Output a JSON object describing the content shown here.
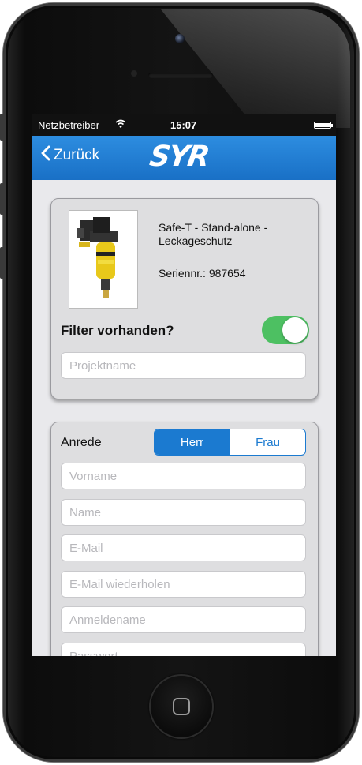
{
  "status_bar": {
    "carrier": "Netzbetreiber",
    "time": "15:07",
    "wifi_icon": "wifi-icon",
    "battery_icon": "battery-icon"
  },
  "nav": {
    "back_label": "Zurück",
    "logo_text": "SYR"
  },
  "product": {
    "title": "Safe-T - Stand-alone - Leckageschutz",
    "serial": "Seriennr.: 987654",
    "filter_label": "Filter vorhanden?",
    "filter_enabled": true,
    "project_placeholder": "Projektname"
  },
  "form": {
    "anrede_label": "Anrede",
    "salutation_options": [
      "Herr",
      "Frau"
    ],
    "salutation_selected": "Herr",
    "placeholders": {
      "first_name": "Vorname",
      "last_name": "Name",
      "email": "E-Mail",
      "email_repeat": "E-Mail wiederholen",
      "username": "Anmeldename",
      "password": "Passwort"
    }
  },
  "colors": {
    "nav_blue": "#1b7ad0",
    "toggle_green": "#4dc062",
    "background": "#e9e9ec"
  }
}
